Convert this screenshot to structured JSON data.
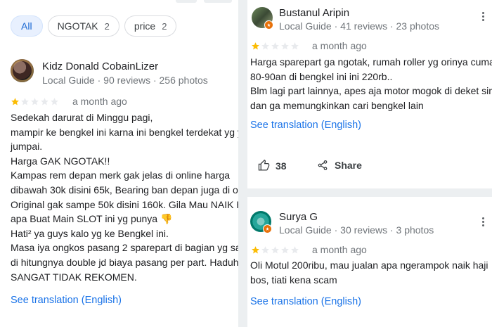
{
  "filters": {
    "chips": [
      {
        "label": "All",
        "count": ""
      },
      {
        "label": "NGOTAK",
        "count": "2"
      },
      {
        "label": "price",
        "count": "2"
      }
    ]
  },
  "review_left": {
    "reviewer_name": "Kidz Donald CobainLizer",
    "meta": "Local Guide · 90 reviews · 256 photos",
    "rating": 1,
    "time": "a month ago",
    "lines": [
      "Sedekah darurat di Minggu pagi,",
      "mampir ke bengkel ini karna ini bengkel terdekat yg yg",
      "jumpai.",
      "Harga GAK NGOTAK!!",
      "Kampas rem depan merk gak jelas di online harga",
      "dibawah 30k disini 65k, Bearing ban depan juga di onlin",
      "Original gak sampe 50k disini 160k. Gila Mau NAIK HA",
      "apa Buat Main SLOT ini yg punya 👎",
      "Hati² ya guys kalo yg ke Bengkel ini.",
      "Masa iya ongkos pasang 2 sparepart di bagian yg sam",
      "di hitungnya double jd biaya pasang per part. Haduh..",
      "SANGAT TIDAK REKOMEN."
    ],
    "see_translation": "See translation (English)"
  },
  "review_right_1": {
    "reviewer_name": "Bustanul Aripin",
    "meta": "Local Guide · 41 reviews · 23 photos",
    "rating": 1,
    "time": "a month ago",
    "lines": [
      "Harga sparepart ga ngotak, rumah roller yg orinya cuma",
      "80-90an di bengkel ini ini 220rb..",
      "Blm lagi part lainnya, apes aja motor mogok di deket sini",
      "dan ga memungkinkan cari bengkel lain"
    ],
    "see_translation": "See translation (English)",
    "like_count": "38",
    "share_label": "Share"
  },
  "review_right_2": {
    "reviewer_name": "Surya G",
    "meta": "Local Guide · 30 reviews · 3 photos",
    "rating": 1,
    "time": "a month ago",
    "lines": [
      "Oli Motul 200ribu, mau jualan apa ngerampok naik haji",
      "bos, tiati kena scam"
    ],
    "see_translation": "See translation (English)"
  },
  "colors": {
    "star_filled": "#fbbc04",
    "star_empty": "#e8eaed",
    "link": "#1a73e8",
    "chip_active_bg": "#e8f0fe",
    "separator": "#eceff1"
  }
}
